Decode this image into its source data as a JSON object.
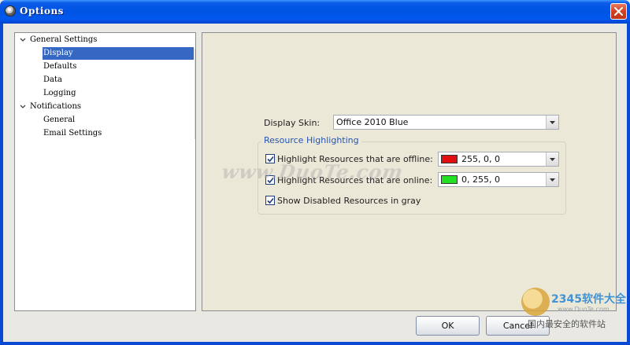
{
  "window": {
    "title": "Options",
    "close_glyph": "✕"
  },
  "tree": {
    "nodes": [
      {
        "label": "General Settings",
        "expanded": true
      },
      {
        "label": "Display",
        "selected": true
      },
      {
        "label": "Defaults"
      },
      {
        "label": "Data"
      },
      {
        "label": "Logging"
      },
      {
        "label": "Notifications",
        "expanded": true
      },
      {
        "label": "General"
      },
      {
        "label": "Email Settings"
      }
    ]
  },
  "display": {
    "skin_label": "Display Skin:",
    "skin_value": "Office 2010 Blue",
    "group_title": "Resource Highlighting",
    "offline": {
      "label": "Highlight Resources that are offline:",
      "checked": true,
      "color_value": "255, 0, 0",
      "color_hex": "#e01010"
    },
    "online": {
      "label": "Highlight Resources that are online:",
      "checked": true,
      "color_value": "0, 255, 0",
      "color_hex": "#22e022"
    },
    "show_disabled": {
      "label": "Show Disabled Resources in gray",
      "checked": true
    }
  },
  "buttons": {
    "ok": "OK",
    "cancel": "Cancel"
  },
  "watermark": {
    "center_text": "www.DuoTe.com",
    "brand": "2345软件大全",
    "url": "www.DuoTe.com",
    "slogan": "国内最安全的软件站"
  },
  "colors": {
    "titlebar": "#0054e3",
    "selection": "#3568c3",
    "group_title": "#2553b5",
    "panel_bg": "#ebe8d8"
  }
}
